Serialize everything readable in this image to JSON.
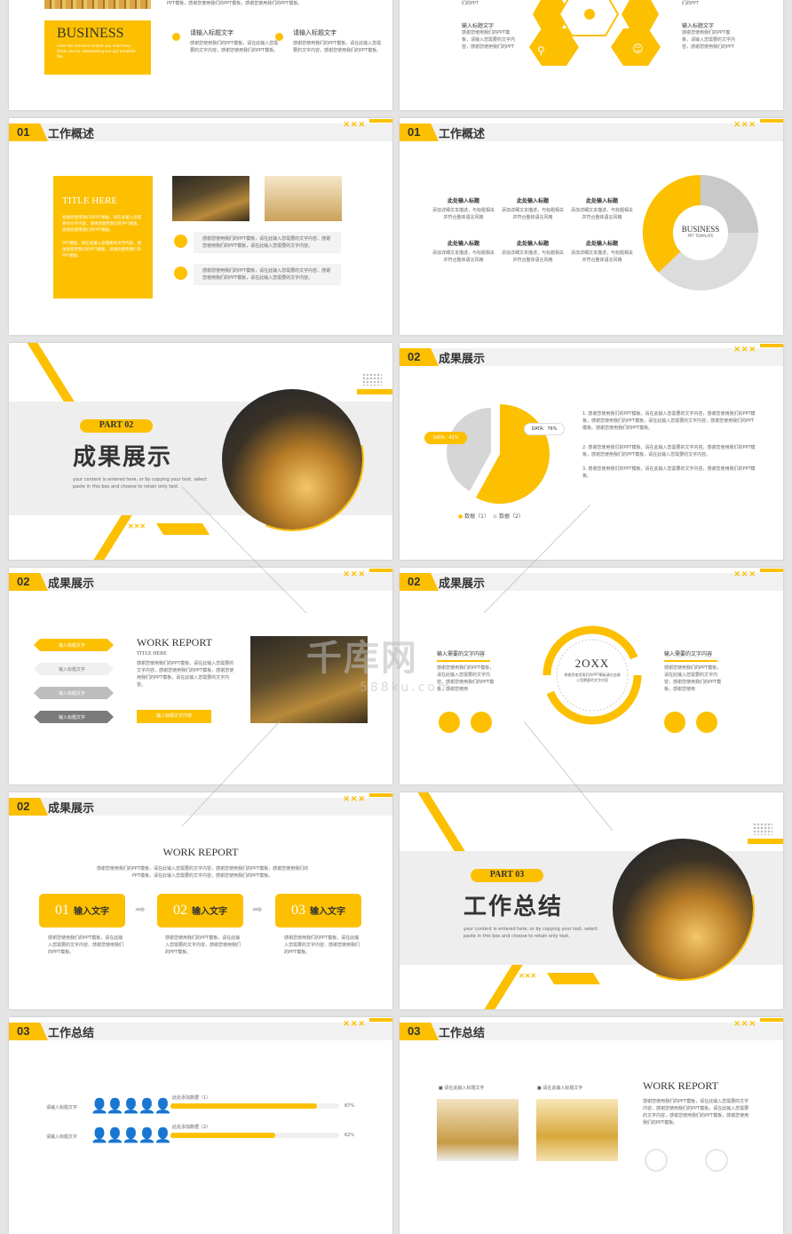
{
  "colors": {
    "accent": "#fcc000",
    "gray": "#d4d4d4",
    "dark": "#333333"
  },
  "s0a": {
    "business": "BUSINESS",
    "tagline": "enter the relevant content you need here. thank you for downloading our ppt template file.",
    "top_text": "PPT模板，感谢您使用我们的PPT模板，感谢您使用我们的PPT模板。",
    "items": [
      {
        "icon": "lock-icon",
        "title": "请输入标题文字",
        "text": "感谢您使用我们的PPT模板，请在此输入您需要的文字内容，感谢您使用我们的PPT模板。"
      },
      {
        "icon": "location-icon",
        "title": "请输入标题文字",
        "text": "感谢您使用我们的PPT模板，请在此输入您需要的文字内容，感谢您使用我们的PPT模板。"
      }
    ]
  },
  "s0b": {
    "top_left": "们的PPT",
    "top_right": "们的PPT",
    "left_title": "输入标题文字",
    "left_text": "感谢您使用我们的PPT模板，请输入您需要的文字内容，感谢您使用我们的PPT",
    "right_title": "输入标题文字",
    "right_text": "感谢您使用我们的PPT模板，请输入您需要的文字内容，感谢您使用我们的PPT"
  },
  "s1": {
    "num": "01",
    "title": "工作概述",
    "box_title": "TITLE HERE",
    "box_p1": "感谢您使用我们的PPT模板，请在此输入您需要的文字内容，感谢您使用我们的PPT模板，感谢您使用我们的PPT模板。",
    "box_p2": "PPT模板，请在此输入您需要的文字内容，感谢您使用我们的PPT模板，感谢您使用我们的PPT模板。",
    "note1": "感谢您使用我们的PPT模板，请在此输入您需要的文字内容，感谢您使用我们的PPT模板，请在此输入您需要的文字内容。",
    "note2": "感谢您使用我们的PPT模板，请在此输入您需要的文字内容，感谢您使用我们的PPT模板，请在此输入您需要的文字内容。"
  },
  "s2": {
    "num": "01",
    "title": "工作概述",
    "items": [
      {
        "h": "此处输入标题",
        "t": "添加详细文本描述，与标题相关并符合整体语言风格"
      },
      {
        "h": "此处输入标题",
        "t": "添加详细文本描述，与标题相关并符合整体语言风格"
      },
      {
        "h": "此处输入标题",
        "t": "添加详细文本描述，与标题相关并符合整体语言风格"
      },
      {
        "h": "此处输入标题",
        "t": "添加详细文本描述，与标题相关并符合整体语言风格"
      },
      {
        "h": "此处输入标题",
        "t": "添加详细文本描述，与标题相关并符合整体语言风格"
      },
      {
        "h": "此处输入标题",
        "t": "添加详细文本描述，与标题相关并符合整体语言风格"
      }
    ],
    "ring_title": "BUSINESS",
    "ring_sub": "PPT TEMPLATE"
  },
  "s3": {
    "part": "PART 02",
    "title": "成果展示",
    "sub": "your content is entered here, or by copying your text, select paste in this box and choose to retain only text."
  },
  "s4": {
    "num": "02",
    "title": "成果展示",
    "label1": "DATA：42%",
    "label2": "DATA：76%",
    "legend1": "数据（1）",
    "legend2": "数据（2）",
    "list": [
      "1. 感谢您使用我们的PPT模板，请在此输入您需要的文字内容，感谢您使用我们的PPT模板，感谢您使用我们的PPT模板，请在此输入您需要的文字内容，感谢您使用我们的PPT模板。感谢您使用我们的PPT模板。",
      "2. 感谢您使用我们的PPT模板，请在此输入您需要的文字内容，感谢您使用我们的PPT模板，感谢您使用我们的PPT模板，请在此输入您需要的文字内容。",
      "3. 感谢您使用我们的PPT模板，请在此输入您需要的文字内容，感谢您使用我们的PPT模板。"
    ]
  },
  "s5": {
    "num": "02",
    "title": "成果展示",
    "steps": [
      "输入标题文字",
      "输入标题文字",
      "输入标题文字",
      "输入标题文字"
    ],
    "wr": "WORK REPORT",
    "th": "TITLE HERE",
    "text": "感谢您使用我们的PPT模板，请在此输入您需要的文字内容，感谢您使用我们的PPT模板，感谢您使用我们的PPT模板，请在此输入您需要的文字内容。",
    "btn": "输入标题文字内容"
  },
  "s6": {
    "num": "02",
    "title": "成果展示",
    "ltitle": "输入需要的文字内容",
    "ltext": "感谢您使用我们的PPT模板，请在此输入您需要的文字内容，感谢您使用我们的PPT模板，感谢您使用",
    "year": "2OXX",
    "ctext": "感谢您使用我们的PPT模板请在此输入您需要的文字内容",
    "rtitle": "输入需要的文字内容",
    "rtext": "感谢您使用我们的PPT模板，请在此输入您需要的文字内容，感谢您使用我们的PPT模板，感谢您使用"
  },
  "s7": {
    "num": "02",
    "title": "成果展示",
    "wr": "WORK REPORT",
    "intro": "感谢您使用我们的PPT模板，请在此输入您需要的文字内容，感谢您使用我们的PPT模板，感谢您使用我们的PPT模板，请在此输入您需要的文字内容，感谢您使用我们的PPT模板。",
    "steps": [
      {
        "n": "01",
        "l": "输入文字",
        "t": "感谢您使用我们的PPT模板，请在此输入您需要的文字内容，感谢您使用我们的PPT模板。"
      },
      {
        "n": "02",
        "l": "输入文字",
        "t": "感谢您使用我们的PPT模板，请在此输入您需要的文字内容，感谢您使用我们的PPT模板。"
      },
      {
        "n": "03",
        "l": "输入文字",
        "t": "感谢您使用我们的PPT模板，请在此输入您需要的文字内容，感谢您使用我们的PPT模板。"
      }
    ]
  },
  "s8": {
    "part": "PART 03",
    "title": "工作总结",
    "sub": "your content is entered here, or by copying your text, select paste in this box and choose to retain only text."
  },
  "s9": {
    "num": "03",
    "title": "工作总结",
    "rows": [
      {
        "label": "请输入标题文字",
        "bar_label": "此处添加数据（1）",
        "pct": "87%",
        "value": 0.87
      },
      {
        "label": "请输入标题文字",
        "bar_label": "此处添加数据（2）",
        "pct": "62%",
        "value": 0.62
      }
    ]
  },
  "s10": {
    "num": "03",
    "title": "工作总结",
    "cap1": "请在此输入标题文字",
    "cap2": "请在此输入标题文字",
    "wr": "WORK REPORT",
    "text": "感谢您使用我们的PPT模板，请在此输入您需要的文字内容，感谢您使用我们的PPT模板，请在此输入您需要的文字内容，感谢您使用我们的PPT模板，感谢您使用我们的PPT模板。"
  },
  "watermark": {
    "brand": "千库网",
    "url": "588ku.com"
  }
}
